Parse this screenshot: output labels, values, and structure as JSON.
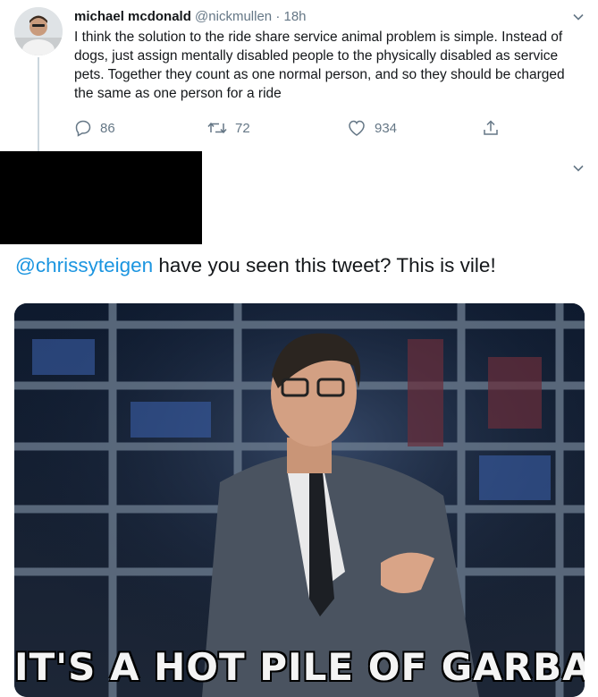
{
  "tweet": {
    "author_name": "michael mcdonald",
    "author_handle": "@nickmullen",
    "separator": "·",
    "timestamp": "18h",
    "text": "I think the solution to the ride share service animal problem is simple. Instead of dogs, just assign mentally disabled people to the physically disabled as service pets. Together they count as one normal person, and so they should be charged the same as one person for a ride",
    "actions": {
      "reply_count": "86",
      "retweet_count": "72",
      "like_count": "934"
    }
  },
  "reply": {
    "mention": "@chrissyteigen",
    "text": " have you seen this tweet? This is vile!"
  },
  "media": {
    "caption": "IT'S A HOT PILE OF GARBAGE"
  },
  "icons": {
    "more": "chevron-down-icon",
    "reply": "comment-icon",
    "retweet": "retweet-icon",
    "like": "heart-icon",
    "share": "share-icon"
  },
  "colors": {
    "link": "#1b95e0",
    "secondary_text": "#657786",
    "thread_line": "#ccd6dd"
  }
}
